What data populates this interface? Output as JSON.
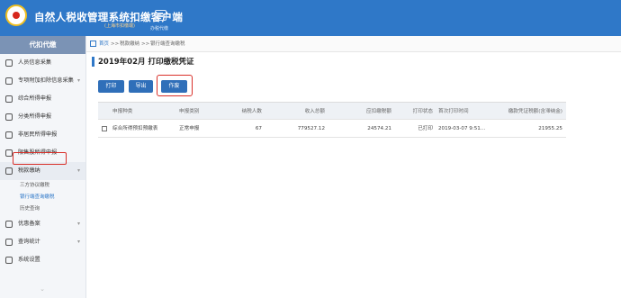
{
  "header": {
    "app_title": "自然人税收管理系统扣缴客户端",
    "app_subtitle": "(上海市扣缴端)",
    "tray_label": "办税代缴"
  },
  "sidebar": {
    "title": "代扣代缴",
    "items": [
      {
        "label": "人员信息采集",
        "chev": ""
      },
      {
        "label": "专项附加扣除信息采集",
        "chev": "▾"
      },
      {
        "label": "综合所得申报",
        "chev": ""
      },
      {
        "label": "分类所得申报",
        "chev": ""
      },
      {
        "label": "非居民所得申报",
        "chev": ""
      },
      {
        "label": "限售股所得申报",
        "chev": ""
      },
      {
        "label": "税款缴纳",
        "chev": "▾"
      }
    ],
    "sub_items": [
      {
        "label": "三方协议缴税"
      },
      {
        "label": "银行端查询缴税"
      },
      {
        "label": "历史查询"
      }
    ],
    "items_bottom": [
      {
        "label": "优惠备案",
        "chev": "▾"
      },
      {
        "label": "查询统计",
        "chev": "▾"
      },
      {
        "label": "系统设置",
        "chev": ""
      }
    ]
  },
  "breadcrumb": {
    "home": "首页",
    "sep1": ">>",
    "level1": "税款缴纳",
    "sep2": ">>",
    "level2": "银行端查询缴税"
  },
  "page": {
    "title": "2019年02月 打印缴税凭证"
  },
  "toolbar": {
    "print_label": "打印",
    "export_label": "导出",
    "void_label": "作废"
  },
  "table": {
    "headers": [
      "申报种类",
      "申报类别",
      "纳税人数",
      "收入总额",
      "应扣缴税额",
      "打印状态",
      "首次打印时间",
      "缴款凭证税额(含滞纳金)"
    ],
    "rows": [
      [
        "综合所得预扣预缴表",
        "正常申报",
        "67",
        "779527.12",
        "24574.21",
        "已打印",
        "2019-03-07 9:51...",
        "21955.25"
      ]
    ]
  },
  "colors": {
    "header_bg": "#2f78c8",
    "button_bg": "#2f6fb9",
    "highlight": "#d9302a"
  }
}
